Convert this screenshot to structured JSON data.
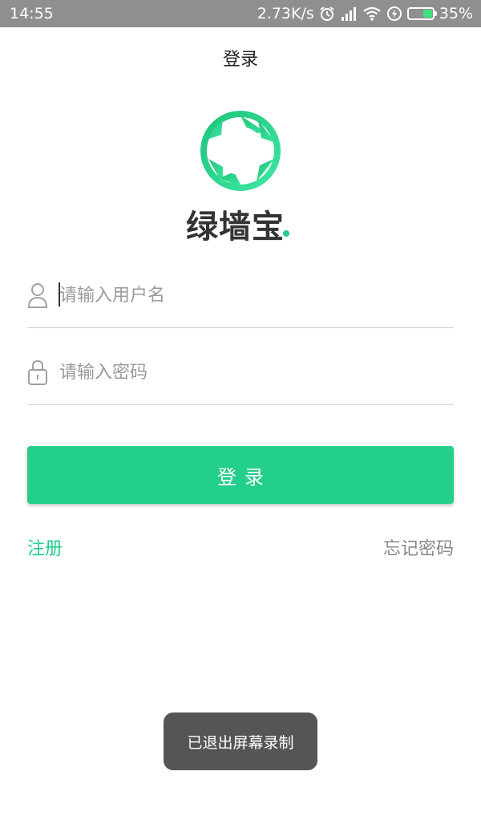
{
  "status_bar": {
    "time": "14:55",
    "network_speed": "2.73K/s",
    "battery_percent": "35%",
    "icons": [
      "alarm-icon",
      "signal-icon",
      "wifi-icon",
      "charging-icon",
      "battery-icon"
    ]
  },
  "header": {
    "title": "登录"
  },
  "logo": {
    "text": "绿墙宝",
    "brand_color": "#24cf8c"
  },
  "form": {
    "username_placeholder": "请输入用户名",
    "username_value": "",
    "password_placeholder": "请输入密码",
    "password_value": "",
    "login_label": "登录"
  },
  "links": {
    "register": "注册",
    "forgot_password": "忘记密码"
  },
  "toast": {
    "message": "已退出屏幕录制"
  },
  "colors": {
    "accent": "#24cf8c",
    "status_bar_bg": "#8f8f8f",
    "toast_bg": "#555555"
  }
}
